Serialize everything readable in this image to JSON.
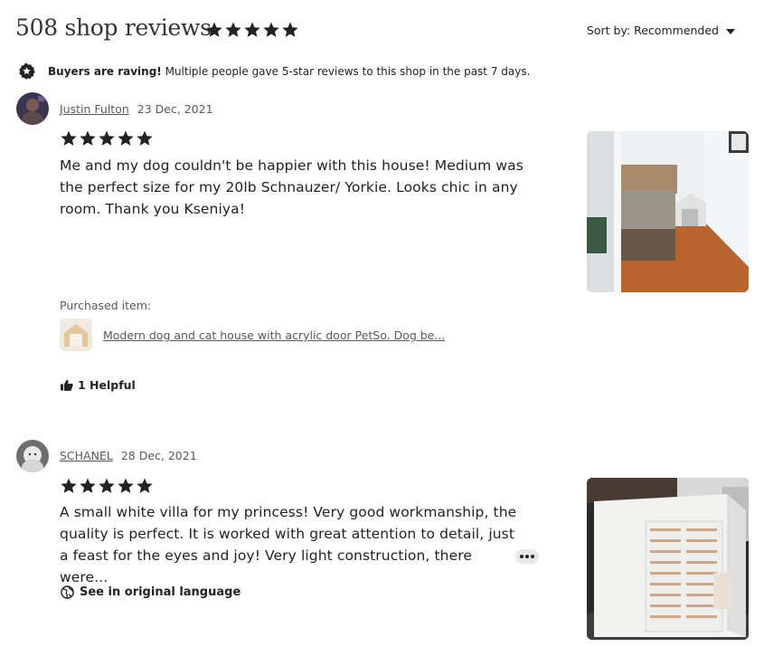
{
  "header": {
    "title": "508 shop reviews",
    "rating_stars": 5,
    "sort_label": "Sort by: Recommended"
  },
  "notice": {
    "bold": "Buyers are raving!",
    "text": " Multiple people gave 5-star reviews to this shop in the past 7 days."
  },
  "reviews": [
    {
      "reviewer": "Justin Fulton",
      "date": "23 Dec, 2021",
      "stars": 5,
      "text": "Me and my dog couldn't be happier with this house! Medium was the perfect size for my 20lb Schnauzer/ Yorkie. Looks chic in any room. Thank you Kseniya!",
      "purchased_label": "Purchased item:",
      "item_title": "Modern dog and cat house with acrylic door PetSo. Dog be...",
      "helpful_label": "1 Helpful"
    },
    {
      "reviewer": "SCHANEL",
      "date": "28 Dec, 2021",
      "stars": 5,
      "text": "A small white villa for my princess! Very good workmanship, the quality is perfect. It is worked with great attention to detail, just a feast for the eyes and joy! Very light construction, there were...",
      "translate_label": "See in original language"
    }
  ],
  "colors": {
    "text": "#222222",
    "muted": "#595959",
    "badge": "#222222"
  }
}
